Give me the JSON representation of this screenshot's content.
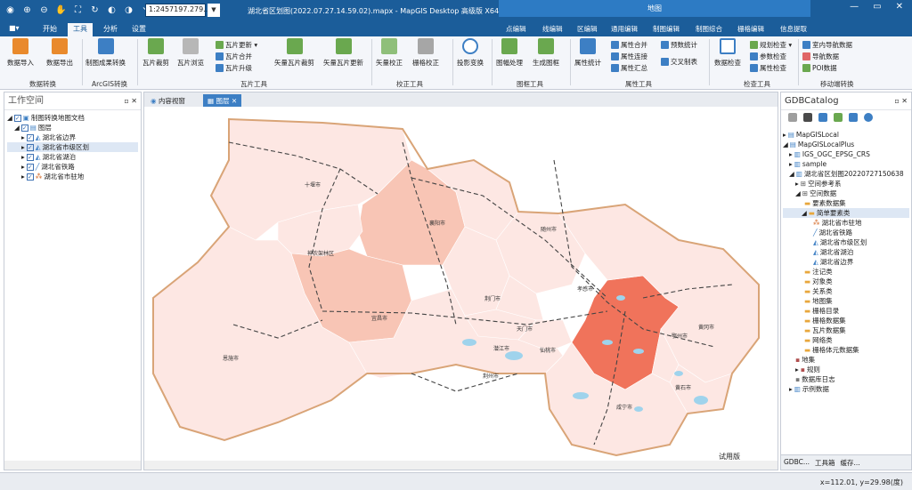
{
  "title_bar": {
    "scale": "1:2457197.279...",
    "title": "湖北省区划图(2022.07.27.14.59.02).mapx - MapGIS Desktop 高级版 X64",
    "context_group": "地图",
    "controls": [
      "—",
      "▭",
      "✕"
    ]
  },
  "tabs": {
    "file": "■▾",
    "home": "开始",
    "tools": "工具",
    "analysis": "分析",
    "settings": "设置"
  },
  "context_tabs": [
    "点编辑",
    "线编辑",
    "区编辑",
    "通用编辑",
    "制图编辑",
    "制图综合",
    "栅格编辑",
    "信息提取"
  ],
  "ribbon": {
    "data_import": "数据导入",
    "data_export": "数据导出",
    "group_data_convert": "数据转换",
    "mapping_convert": "制图成果转换",
    "group_arcgis": "ArcGIS转换",
    "tile_crop": "瓦片裁剪",
    "tile_browse": "瓦片浏览",
    "tile_update": "瓦片更新 ▾",
    "tile_merge": "瓦片合并",
    "tile_upgrade": "瓦片升级",
    "vector_tile_crop": "矢量瓦片裁剪",
    "vector_tile_update": "矢量瓦片更新",
    "group_tile": "瓦片工具",
    "vector_correct": "矢量校正",
    "raster_correct": "栅格校正",
    "group_correct": "校正工具",
    "projection": "投影变换",
    "frame_process": "图幅处理",
    "gen_frame": "生成图框",
    "group_frame": "图框工具",
    "attr_stats": "属性统计",
    "attr_merge": "属性合并",
    "attr_join": "属性连接",
    "attr_summary": "属性汇总",
    "group_attr": "属性工具",
    "prelim_stats": "预数统计",
    "cross_table": "交叉制表",
    "data_check": "数据检查",
    "rule_check": "规划检查 ▾",
    "param_check": "参数检查",
    "attr_check": "属性检查",
    "group_check": "检查工具",
    "indoor_nav": "室内导航数据",
    "nav_data": "导航数据",
    "poi_data": "POI数据",
    "group_mobile": "移动端转换"
  },
  "left_panel": {
    "title": "工作空间",
    "pin": "▫ ✕",
    "tree": [
      "制图转换地图文档",
      "图层",
      "湖北省边界",
      "湖北省市级区划",
      "湖北省湖泊",
      "湖北省铁路",
      "湖北省市驻地"
    ]
  },
  "doc_tabs": {
    "content_view": "内容视窗",
    "map_tab": "图层",
    "close": "✕"
  },
  "map": {
    "cities": [
      "十堰市",
      "襄阳市",
      "随州市",
      "神农架林区",
      "宜昌市",
      "荆门市",
      "孝感市",
      "恩施市",
      "天门市",
      "潜江市",
      "仙桃市",
      "荆州市",
      "黄冈市",
      "鄂州市",
      "黄石市",
      "咸宁市"
    ],
    "trial": "试用版"
  },
  "colors": {
    "base": "#fde7e3",
    "light": "#f8c5b5",
    "medium": "#f3a58f",
    "wuhan": "#f0735b",
    "border": "#d9a477",
    "lake": "#9fd3ec",
    "rail": "#444444"
  },
  "right_panel": {
    "title": "GDBCatalog",
    "pin": "▫ ✕",
    "tree": [
      "MapGISLocal",
      "MapGISLocalPlus",
      "IGS_OGC_EPSG_CRS",
      "sample",
      "湖北省区划图20220727150638",
      "空间参考系",
      "空间数据",
      "要素数据集",
      "简单要素类",
      "湖北省市驻地",
      "湖北省铁路",
      "湖北省市级区划",
      "湖北省湖泊",
      "湖北省边界",
      "注记类",
      "对象类",
      "关系类",
      "地图集",
      "栅格目录",
      "栅格数据集",
      "瓦片数据集",
      "网络类",
      "栅格体元数据集",
      "地集",
      "规则",
      "数据库日志",
      "示例数据"
    ],
    "bottom_tabs": [
      "GDBC...",
      "工具箱",
      "缓存..."
    ]
  },
  "status": {
    "coords": "x=112.01, y=29.98(度)"
  }
}
